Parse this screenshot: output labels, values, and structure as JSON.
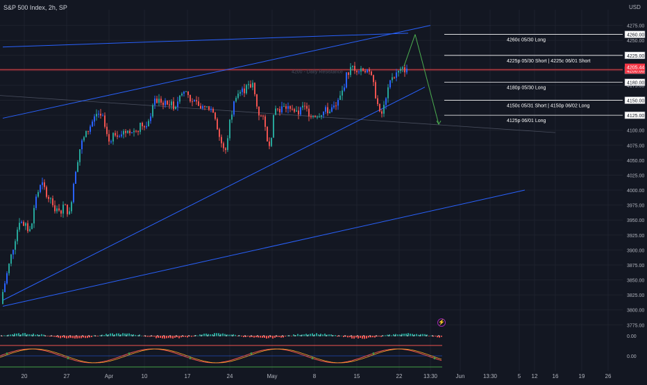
{
  "header": {
    "symbol_title": "S&P 500 Index, 2h, SP",
    "currency": "USD"
  },
  "colors": {
    "background": "#131722",
    "up": "#26a69a",
    "up_blue": "#2962ff",
    "down": "#ef5350",
    "trendline": "#2962ff",
    "annotation_line": "#ffffff",
    "arrow": "#4caf50",
    "price_badge": "#f23645",
    "resistance": "#b22833"
  },
  "chart_data": [
    {
      "type": "candlestick",
      "title": "S&P 500 Index, 2h, SP",
      "ylabel": "USD",
      "ylim": [
        3762,
        4285
      ],
      "y_ticks": [
        4275,
        4250,
        4225,
        4200,
        4175,
        4150,
        4125,
        4100,
        4075,
        4050,
        4025,
        4000,
        3975,
        3950,
        3925,
        3900,
        3875,
        3850,
        3825,
        3800,
        3775
      ],
      "x_tick_labels": [
        "20",
        "27",
        "Apr",
        "10",
        "17",
        "24",
        "May",
        "8",
        "15",
        "22",
        "13:30",
        "Jun",
        "13:30",
        "5",
        "12",
        "16",
        "19",
        "26"
      ],
      "x_range": [
        "2023-03-17",
        "2023-06-27"
      ],
      "grid": true,
      "current_price": {
        "label": "4205.44",
        "value": 4205.44
      },
      "price_levels": [
        {
          "value": 4260,
          "label": "4260.00",
          "note": "4260c 05/30 Long"
        },
        {
          "value": 4225,
          "label": "4225.00",
          "note": "4225p 05/30 Short | 4225c 06/01 Short"
        },
        {
          "value": 4200,
          "label": "4200.00",
          "note": ""
        },
        {
          "value": 4180,
          "label": "4180.00",
          "note": "4180p 05/30 Long"
        },
        {
          "value": 4150,
          "label": "4150.00",
          "note": "4150c 05/31 Short | 4150p 06/02 Long"
        },
        {
          "value": 4125,
          "label": "4125.00",
          "note": "4125p 06/01 Long"
        }
      ],
      "resistance_label": "4200 - Daily Resistance",
      "price_path": [
        [
          "2023-03-17",
          3830
        ],
        [
          "2023-03-20",
          3950
        ],
        [
          "2023-03-22",
          3930
        ],
        [
          "2023-03-23",
          3990
        ],
        [
          "2023-03-24",
          4010
        ],
        [
          "2023-03-27",
          3960
        ],
        [
          "2023-03-28",
          3975
        ],
        [
          "2023-03-29",
          3960
        ],
        [
          "2023-03-30",
          4030
        ],
        [
          "2023-03-31",
          4075
        ],
        [
          "2023-04-03",
          4130
        ],
        [
          "2023-04-04",
          4120
        ],
        [
          "2023-04-05",
          4080
        ],
        [
          "2023-04-06",
          4095
        ],
        [
          "2023-04-10",
          4100
        ],
        [
          "2023-04-11",
          4110
        ],
        [
          "2023-04-12",
          4100
        ],
        [
          "2023-04-13",
          4145
        ],
        [
          "2023-04-14",
          4150
        ],
        [
          "2023-04-17",
          4140
        ],
        [
          "2023-04-18",
          4160
        ],
        [
          "2023-04-19",
          4165
        ],
        [
          "2023-04-20",
          4150
        ],
        [
          "2023-04-21",
          4140
        ],
        [
          "2023-04-24",
          4135
        ],
        [
          "2023-04-25",
          4090
        ],
        [
          "2023-04-26",
          4060
        ],
        [
          "2023-04-27",
          4120
        ],
        [
          "2023-04-28",
          4160
        ],
        [
          "2023-05-01",
          4175
        ],
        [
          "2023-05-02",
          4130
        ],
        [
          "2023-05-03",
          4115
        ],
        [
          "2023-05-04",
          4070
        ],
        [
          "2023-05-05",
          4135
        ],
        [
          "2023-05-08",
          4140
        ],
        [
          "2023-05-09",
          4125
        ],
        [
          "2023-05-10",
          4140
        ],
        [
          "2023-05-11",
          4130
        ],
        [
          "2023-05-12",
          4125
        ],
        [
          "2023-05-15",
          4135
        ],
        [
          "2023-05-16",
          4140
        ],
        [
          "2023-05-17",
          4160
        ],
        [
          "2023-05-18",
          4195
        ],
        [
          "2023-05-19",
          4205
        ],
        [
          "2023-05-22",
          4200
        ],
        [
          "2023-05-23",
          4165
        ],
        [
          "2023-05-24",
          4120
        ],
        [
          "2023-05-25",
          4150
        ],
        [
          "2023-05-26",
          4190
        ],
        [
          "2023-05-29",
          4205.44
        ]
      ],
      "trendlines": [
        {
          "from": [
            "2023-03-17",
            4239
          ],
          "to": [
            "2023-05-29",
            4262
          ]
        },
        {
          "from": [
            "2023-03-17",
            4120
          ],
          "to": [
            "2023-06-02",
            4275
          ]
        },
        {
          "from": [
            "2023-03-17",
            3816
          ],
          "to": [
            "2023-06-01",
            4172
          ]
        },
        {
          "from": [
            "2023-03-17",
            3806
          ],
          "to": [
            "2023-06-19",
            4000
          ]
        }
      ],
      "projection": [
        [
          "2023-05-29",
          4207
        ],
        [
          "2023-05-30",
          4260
        ],
        [
          "2023-06-01",
          4110
        ]
      ]
    },
    {
      "type": "bar",
      "title": "",
      "ylim": [
        -1,
        1
      ],
      "y_ticks": [
        0.0
      ],
      "y_tick_labels": [
        "0.00"
      ],
      "note": "momentum histogram with zero-line dots"
    },
    {
      "type": "line",
      "title": "",
      "ylim": [
        -1,
        1
      ],
      "y_ticks": [
        0.0
      ],
      "y_tick_labels": [
        "0.00"
      ],
      "note": "oscillator between red upper and green lower bands"
    }
  ]
}
